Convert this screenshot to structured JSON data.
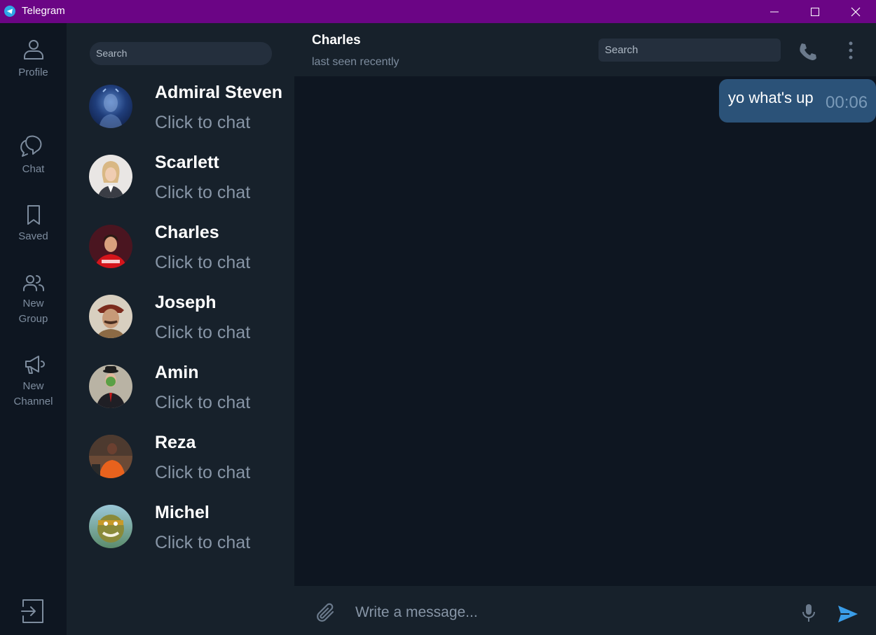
{
  "window": {
    "title": "Telegram",
    "controls": [
      "minimize",
      "maximize",
      "close"
    ]
  },
  "rail": {
    "profile_label": "Profile",
    "chat_label": "Chat",
    "saved_label": "Saved",
    "new_group_line1": "New",
    "new_group_line2": "Group",
    "new_channel_line1": "New",
    "new_channel_line2": "Channel"
  },
  "chatlist": {
    "search_placeholder": "Search",
    "contacts": [
      {
        "name": "Admiral Steven",
        "subtitle": "Click to chat"
      },
      {
        "name": "Scarlett",
        "subtitle": "Click to chat"
      },
      {
        "name": "Charles",
        "subtitle": "Click to chat"
      },
      {
        "name": "Joseph",
        "subtitle": "Click to chat"
      },
      {
        "name": "Amin",
        "subtitle": "Click to chat"
      },
      {
        "name": "Reza",
        "subtitle": "Click to chat"
      },
      {
        "name": "Michel",
        "subtitle": "Click to chat"
      }
    ]
  },
  "chat": {
    "contact_name": "Charles",
    "status": "last seen recently",
    "search_placeholder": "Search",
    "messages": [
      {
        "text": "yo what's up",
        "time": "00:06",
        "outgoing": true
      }
    ],
    "composer_placeholder": "Write a message..."
  },
  "colors": {
    "titlebar": "#6b0585",
    "panel": "#17212b",
    "background": "#0e1621",
    "bubble_out": "#2b5278",
    "accent": "#3a9de8"
  }
}
